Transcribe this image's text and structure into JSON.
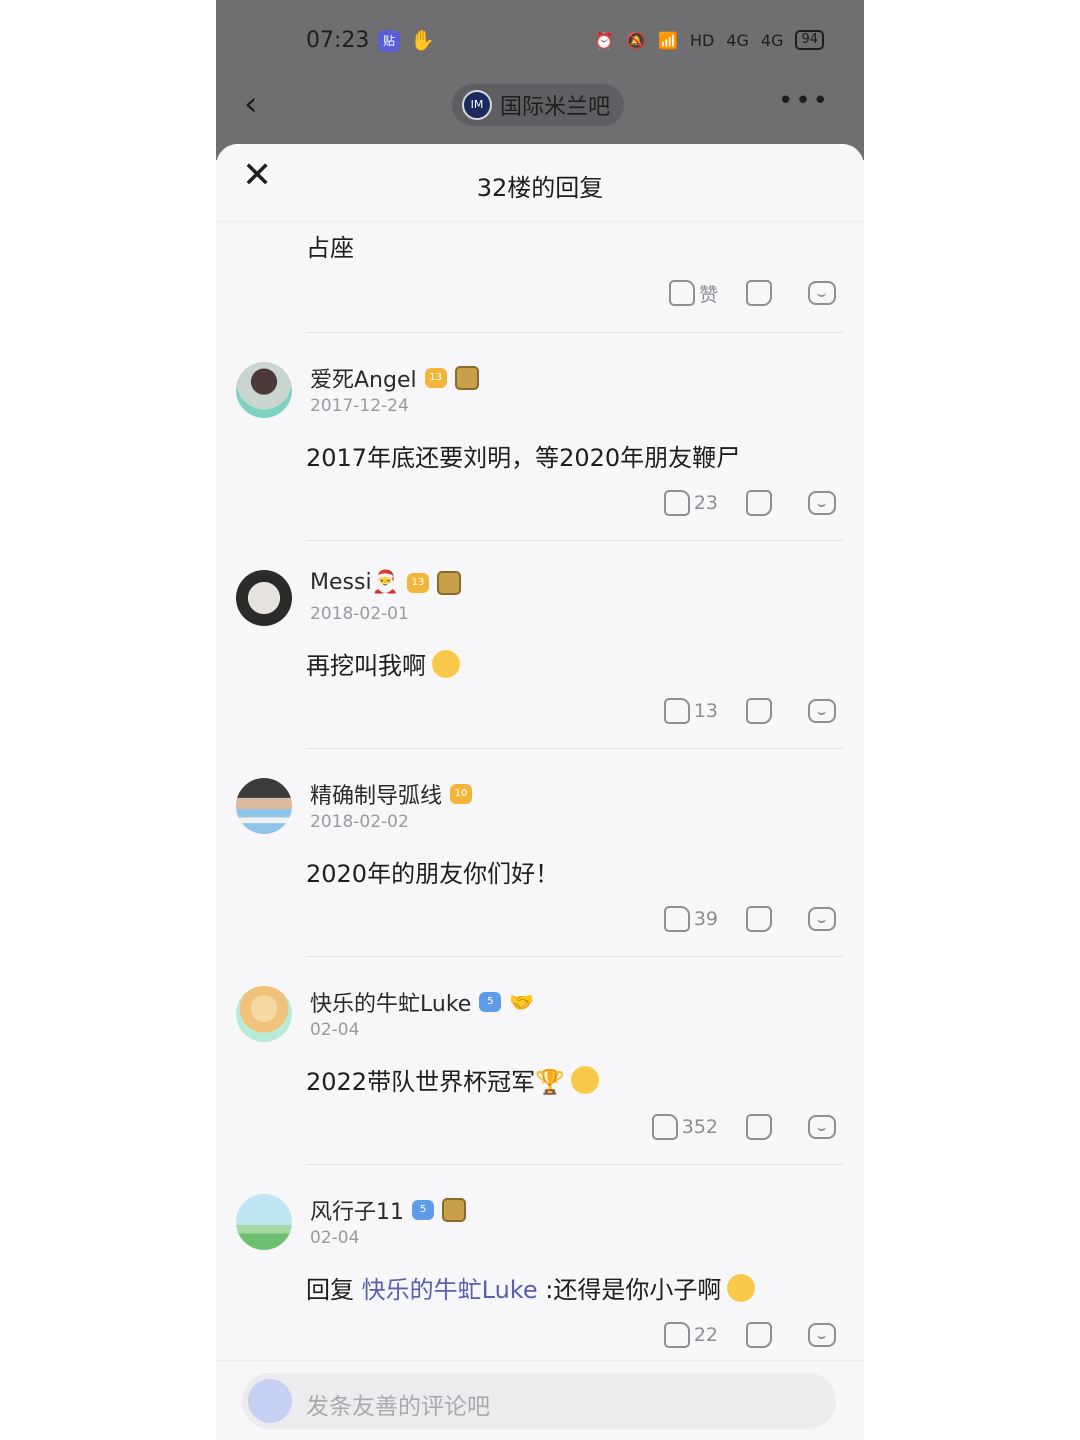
{
  "status_bar": {
    "time": "07:23",
    "app_icon": "贴",
    "hand_icon": "hand-icon",
    "signal_left": "4G",
    "signal_right": "4G",
    "hd": "HD",
    "battery": "94"
  },
  "nav": {
    "back_icon": "‹",
    "forum_title": "国际米兰吧",
    "more_icon": "•••"
  },
  "sheet": {
    "title": "32楼的回复",
    "close_icon": "✕"
  },
  "first": {
    "text": "占座",
    "like_label": "赞"
  },
  "comments": [
    {
      "name": "爱死Angel",
      "level": "13",
      "level_color": "gold",
      "date": "2017-12-24",
      "text": "2017年底还要刘明，等2020年朋友鞭尸",
      "likes": "23"
    },
    {
      "name": "Messi🎅",
      "level": "13",
      "level_color": "gold",
      "date": "2018-02-01",
      "text": "再挖叫我啊",
      "likes": "13"
    },
    {
      "name": "精确制导弧线",
      "level": "10",
      "level_color": "gold",
      "date": "2018-02-02",
      "text": "2020年的朋友你们好！",
      "likes": "39"
    },
    {
      "name": "快乐的牛虻Luke",
      "level": "5",
      "level_color": "blue",
      "date": "02-04",
      "text": "2022带队世界杯冠军🏆",
      "likes": "352"
    },
    {
      "name": "风行子11",
      "level": "5",
      "level_color": "blue",
      "date": "02-04",
      "reply_prefix": "回复",
      "reply_to": "快乐的牛虻Luke",
      "text": ":还得是你小子啊",
      "likes": "22"
    }
  ],
  "composer": {
    "placeholder": "发条友善的评论吧"
  }
}
